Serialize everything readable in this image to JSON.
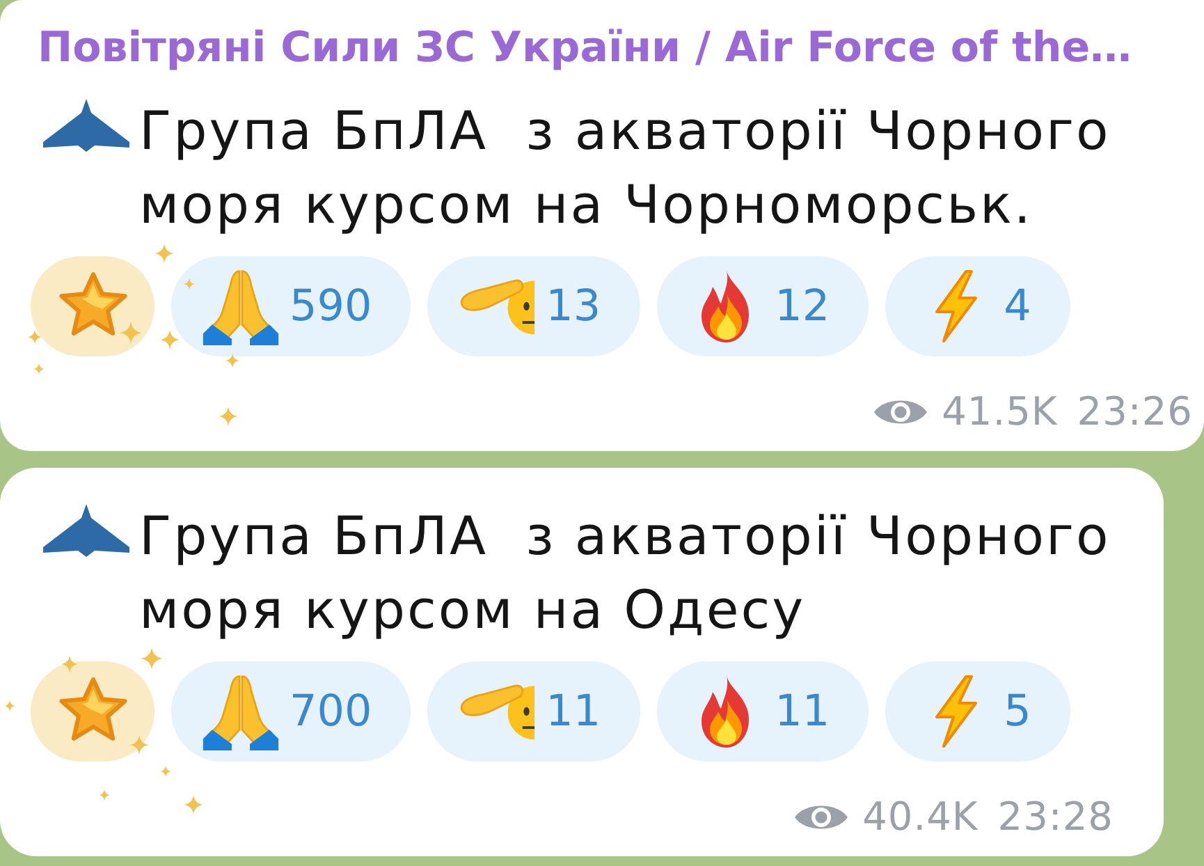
{
  "messages": [
    {
      "author": "Повітряні Сили ЗС України / Air Force of the…",
      "text": "Група БпЛА  з акваторії Чорного моря курсом на Чорноморськ.",
      "reactions": [
        {
          "kind": "star",
          "selected": false
        },
        {
          "kind": "pray",
          "count": "590",
          "selected": false
        },
        {
          "kind": "salute",
          "count": "13",
          "selected": false
        },
        {
          "kind": "fire",
          "count": "12",
          "selected": false
        },
        {
          "kind": "lightning",
          "count": "4",
          "selected": false
        }
      ],
      "views": "41.5K",
      "time": "23:26"
    },
    {
      "text": "Група БпЛА  з акваторії Чорного моря курсом на Одесу",
      "reactions": [
        {
          "kind": "star",
          "selected": false
        },
        {
          "kind": "pray",
          "count": "700",
          "selected": false
        },
        {
          "kind": "salute",
          "count": "11",
          "selected": false
        },
        {
          "kind": "fire",
          "count": "11",
          "selected": false
        },
        {
          "kind": "lightning",
          "count": "5",
          "selected": false
        }
      ],
      "views": "40.4K",
      "time": "23:28"
    }
  ]
}
